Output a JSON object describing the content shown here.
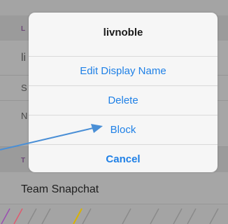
{
  "background": {
    "section_1_header": "L",
    "row_1": "li",
    "row_2_initial": "S",
    "row_3_initial": "N",
    "section_2_header": "T",
    "team_row": "Team Snapchat"
  },
  "sheet": {
    "title": "livnoble",
    "actions": [
      "Edit Display Name",
      "Delete",
      "Block"
    ],
    "cancel": "Cancel"
  },
  "colors": {
    "accent": "#1f80e6",
    "arrow": "#4a8fd6"
  },
  "icons": [
    "annotation-arrow"
  ]
}
